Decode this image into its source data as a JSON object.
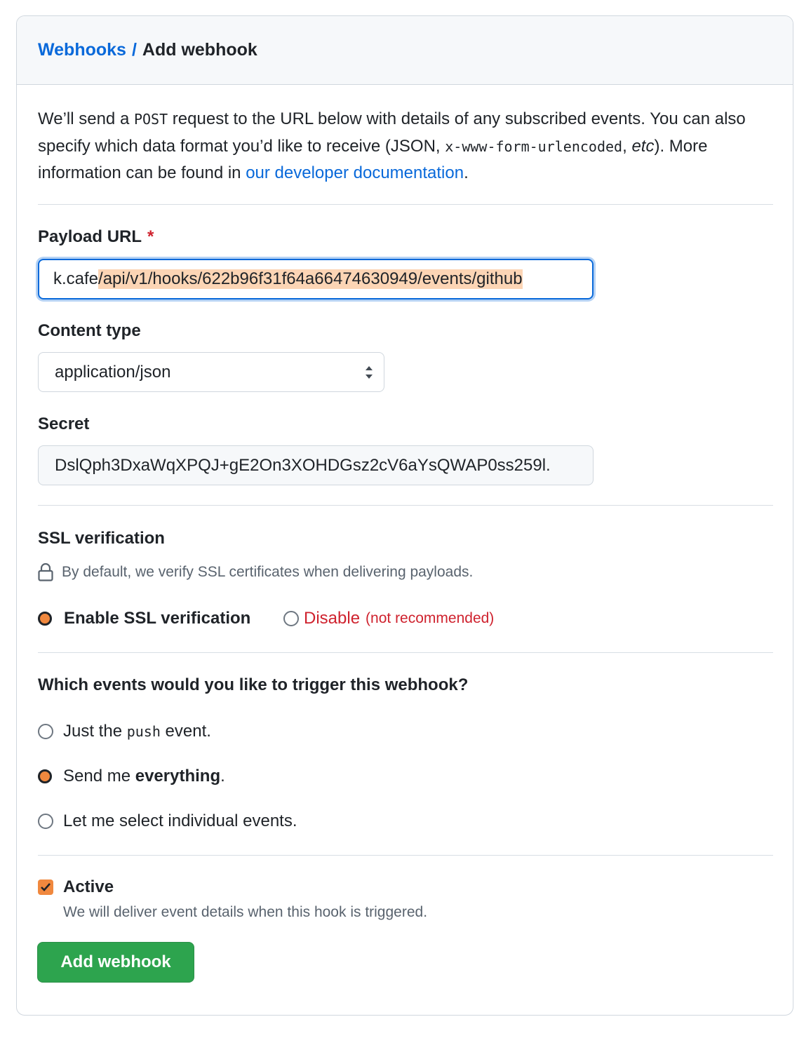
{
  "breadcrumb": {
    "parent": "Webhooks",
    "separator": "/",
    "current": "Add webhook"
  },
  "intro": {
    "part1": "We’ll send a ",
    "method": "POST",
    "part2": " request to the URL below with details of any subscribed events. You can also specify which data format you’d like to receive (JSON, ",
    "format_code": "x-www-form-urlencoded",
    "part3": ", ",
    "etc": "etc",
    "part4": "). More information can be found in ",
    "doc_link": "our developer documentation",
    "part5": "."
  },
  "payload_url": {
    "label": "Payload URL",
    "required_mark": "*",
    "value_visible": "k.cafe",
    "value_highlighted": "/api/v1/hooks/622b96f31f64a66474630949/events/github"
  },
  "content_type": {
    "label": "Content type",
    "selected": "application/json"
  },
  "secret": {
    "label": "Secret",
    "value": "DslQph3DxaWqXPQJ+gE2On3XOHDGsz2cV6aYsQWAP0ss259l."
  },
  "ssl": {
    "title": "SSL verification",
    "note": "By default, we verify SSL certificates when delivering payloads.",
    "enable_label": "Enable SSL verification",
    "disable_label": "Disable",
    "disable_note": "(not recommended)"
  },
  "events": {
    "question": "Which events would you like to trigger this webhook?",
    "option_push_prefix": "Just the ",
    "option_push_code": "push",
    "option_push_suffix": " event.",
    "option_all_prefix": "Send me ",
    "option_all_bold": "everything",
    "option_all_suffix": ".",
    "option_select": "Let me select individual events."
  },
  "active": {
    "label": "Active",
    "description": "We will deliver event details when this hook is triggered."
  },
  "submit_label": "Add webhook",
  "colors": {
    "accent": "#f0883e",
    "link": "#0969da",
    "danger": "#cf222e",
    "primary_button": "#2da44e"
  }
}
